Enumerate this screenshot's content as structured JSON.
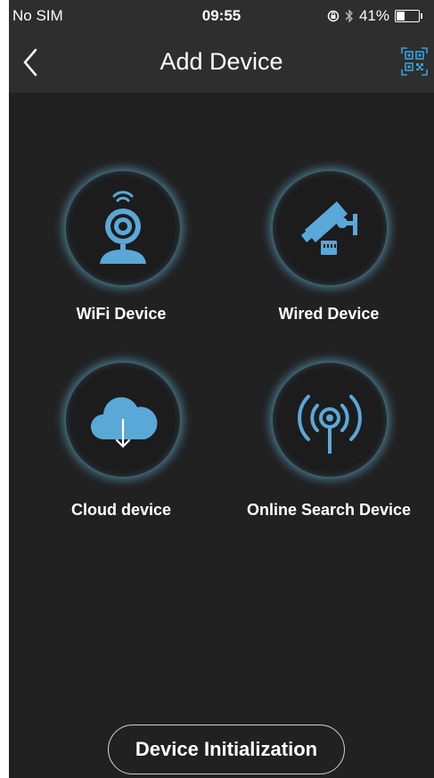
{
  "status_bar": {
    "carrier": "No SIM",
    "time": "09:55",
    "battery_text": "41%",
    "battery_level": 0.41
  },
  "nav": {
    "title": "Add Device",
    "back_icon": "chevron-left-icon",
    "qr_icon": "qr-scan-icon"
  },
  "devices": [
    {
      "label": "WiFi Device",
      "icon": "wifi-camera-icon"
    },
    {
      "label": "Wired Device",
      "icon": "wired-camera-icon"
    },
    {
      "label": "Cloud device",
      "icon": "cloud-download-icon"
    },
    {
      "label": "Online Search Device",
      "icon": "broadcast-antenna-icon"
    }
  ],
  "init_button": {
    "label": "Device Initialization"
  },
  "colors": {
    "background": "#212121",
    "bar": "#2e2e2e",
    "accent": "#5aa8d8",
    "ring_glow": "#60b2d8"
  }
}
